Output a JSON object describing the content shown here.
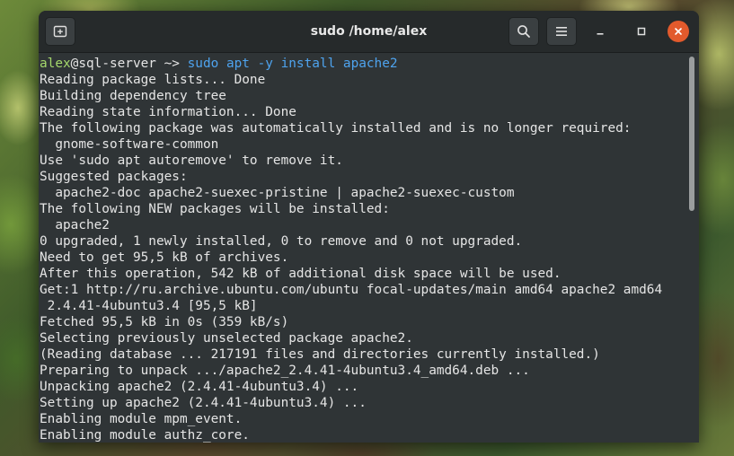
{
  "window": {
    "title": "sudo /home/alex"
  },
  "icons": {
    "new_tab": "new-tab-icon",
    "search": "search-icon",
    "menu": "hamburger-menu-icon",
    "minimize": "minimize-icon",
    "maximize": "maximize-icon",
    "close": "close-icon"
  },
  "colors": {
    "prompt_user": "#a5d86c",
    "command": "#4ea3ee",
    "close_button": "#e25a2c",
    "terminal_bg": "#2f3436"
  },
  "terminal": {
    "prompt": {
      "user": "alex",
      "at": "@",
      "host": "sql-server",
      "path": " ~> ",
      "command": "sudo apt -y install apache2"
    },
    "lines": [
      "Reading package lists... Done",
      "Building dependency tree",
      "Reading state information... Done",
      "The following package was automatically installed and is no longer required:",
      "  gnome-software-common",
      "Use 'sudo apt autoremove' to remove it.",
      "Suggested packages:",
      "  apache2-doc apache2-suexec-pristine | apache2-suexec-custom",
      "The following NEW packages will be installed:",
      "  apache2",
      "0 upgraded, 1 newly installed, 0 to remove and 0 not upgraded.",
      "Need to get 95,5 kB of archives.",
      "After this operation, 542 kB of additional disk space will be used.",
      "Get:1 http://ru.archive.ubuntu.com/ubuntu focal-updates/main amd64 apache2 amd64",
      " 2.4.41-4ubuntu3.4 [95,5 kB]",
      "Fetched 95,5 kB in 0s (359 kB/s)",
      "Selecting previously unselected package apache2.",
      "(Reading database ... 217191 files and directories currently installed.)",
      "Preparing to unpack .../apache2_2.4.41-4ubuntu3.4_amd64.deb ...",
      "Unpacking apache2 (2.4.41-4ubuntu3.4) ...",
      "Setting up apache2 (2.4.41-4ubuntu3.4) ...",
      "Enabling module mpm_event.",
      "Enabling module authz_core."
    ]
  }
}
